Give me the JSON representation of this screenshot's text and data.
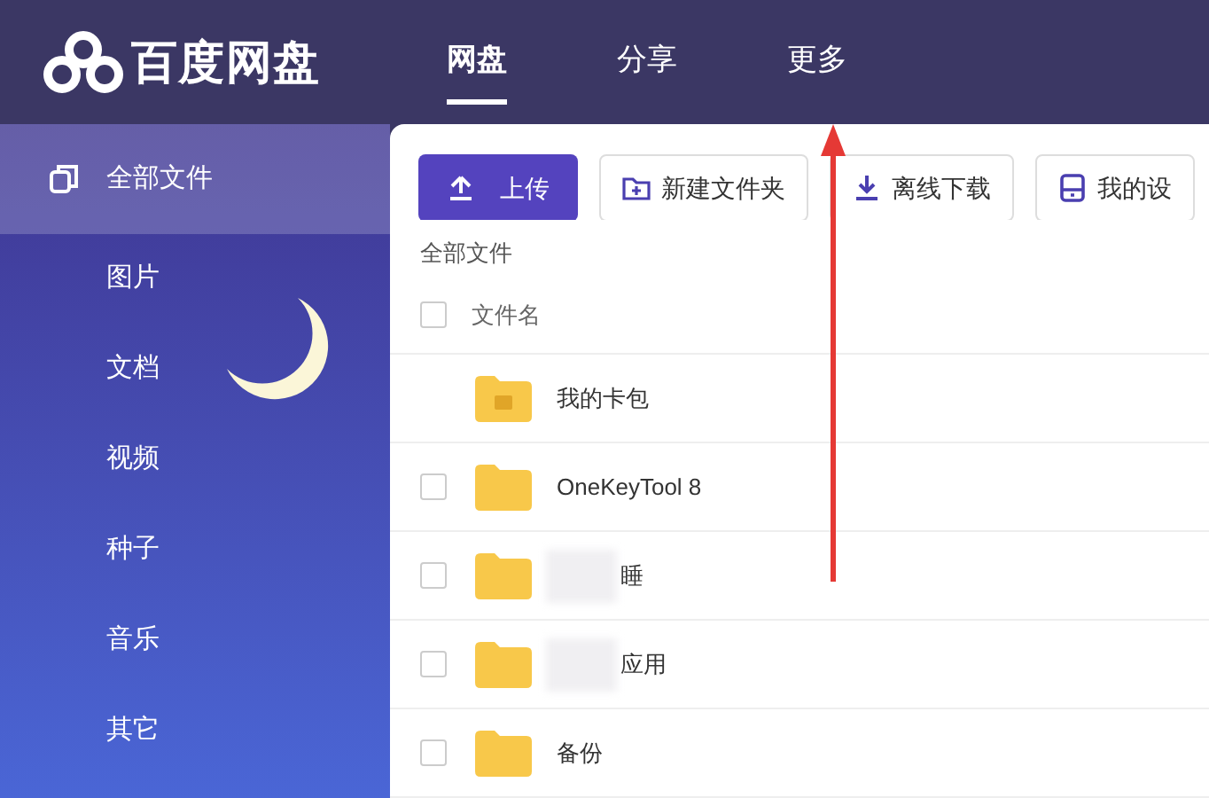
{
  "app": {
    "title": "百度网盘"
  },
  "nav": [
    {
      "label": "网盘",
      "selected": true
    },
    {
      "label": "分享",
      "selected": false
    },
    {
      "label": "更多",
      "selected": false
    }
  ],
  "sidebar": {
    "items": [
      {
        "label": "全部文件",
        "selected": true
      },
      {
        "label": "图片",
        "selected": false
      },
      {
        "label": "文档",
        "selected": false
      },
      {
        "label": "视频",
        "selected": false
      },
      {
        "label": "种子",
        "selected": false
      },
      {
        "label": "音乐",
        "selected": false
      },
      {
        "label": "其它",
        "selected": false
      }
    ]
  },
  "toolbar": [
    {
      "label": "上传",
      "kind": "primary"
    },
    {
      "label": "新建文件夹",
      "kind": "folder"
    },
    {
      "label": "离线下载",
      "kind": "download"
    },
    {
      "label": "我的设",
      "kind": "device"
    }
  ],
  "breadcrumb": "全部文件",
  "table": {
    "columns": [
      "文件名"
    ],
    "select_all": {
      "checked": false
    },
    "rows": [
      {
        "name": "我的卡包",
        "kind": "card",
        "blurred": false
      },
      {
        "name": "OneKeyTool 8",
        "kind": "folder",
        "checked": false,
        "blurred": false
      },
      {
        "name": "睡",
        "kind": "folder",
        "checked": false,
        "blurred": true
      },
      {
        "name": "应用",
        "kind": "folder",
        "checked": false,
        "blurred": true
      },
      {
        "name": "备份",
        "kind": "folder",
        "checked": false,
        "blurred": false
      }
    ]
  },
  "annotation": {
    "kind": "arrow"
  }
}
